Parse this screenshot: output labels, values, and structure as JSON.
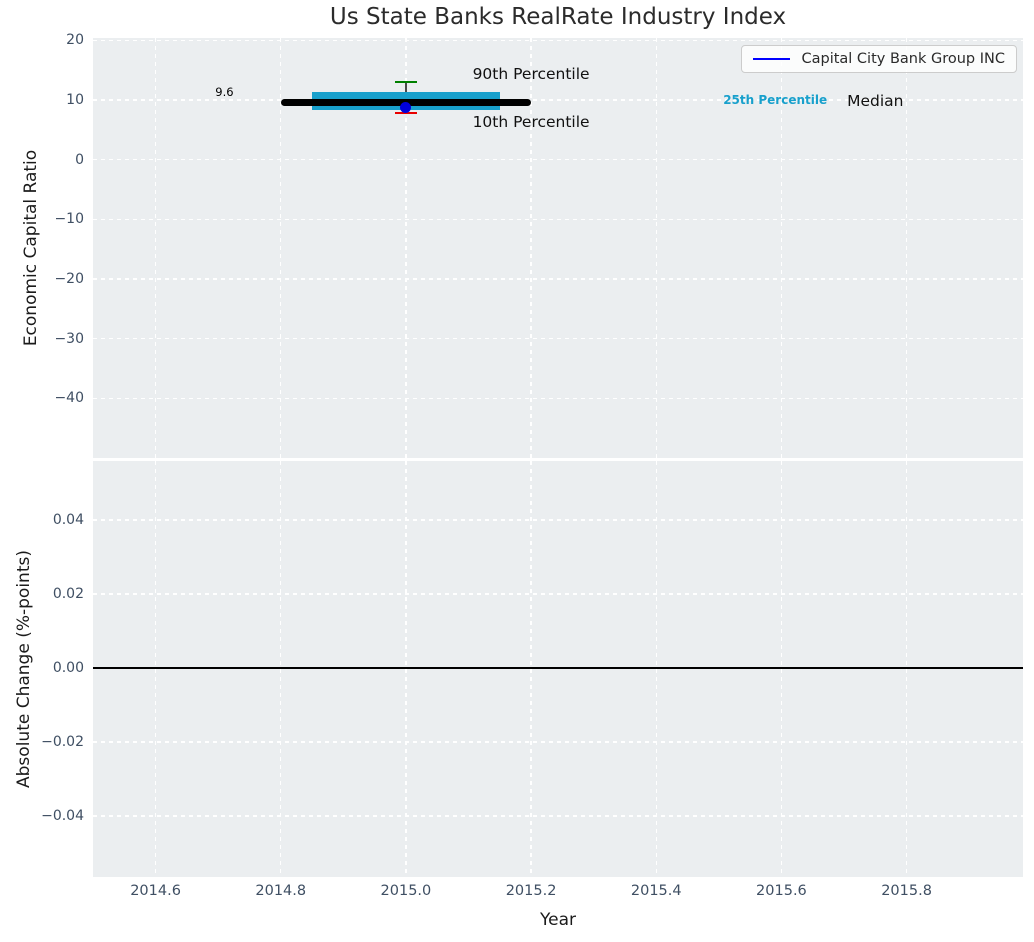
{
  "chart_data": {
    "type": "boxplot",
    "title": "Us State Banks RealRate Industry Index",
    "xlabel": "Year",
    "xlim": [
      2014.5,
      2015.986
    ],
    "xticks": [
      {
        "v": 2014.6,
        "label": "2014.6"
      },
      {
        "v": 2014.8,
        "label": "2014.8"
      },
      {
        "v": 2015.0,
        "label": "2015.0"
      },
      {
        "v": 2015.2,
        "label": "2015.2"
      },
      {
        "v": 2015.4,
        "label": "2015.4"
      },
      {
        "v": 2015.6,
        "label": "2015.6"
      },
      {
        "v": 2015.8,
        "label": "2015.8"
      }
    ],
    "legend": {
      "label": "Capital City Bank Group INC",
      "line_color": "#0000ff",
      "position": "top-right"
    },
    "grid": true,
    "top_panel": {
      "ylabel": "Economic Capital Ratio",
      "ylim": [
        -50,
        20.4
      ],
      "yticks": [
        {
          "v": 20,
          "label": "20"
        },
        {
          "v": 10,
          "label": "10"
        },
        {
          "v": 0,
          "label": "0"
        },
        {
          "v": -10,
          "label": "−10"
        },
        {
          "v": -20,
          "label": "−20"
        },
        {
          "v": -30,
          "label": "−30"
        },
        {
          "v": -40,
          "label": "−40"
        }
      ],
      "industry_box": {
        "year": 2015.0,
        "median": 9.6,
        "p25": 8.4,
        "p75": 11.4,
        "p10": 7.8,
        "p90": 13.0,
        "median_halfwidth_years": 0.2,
        "box_halfwidth_years": 0.15,
        "cap_halfwidth_years": 0.018,
        "colors": {
          "median": "#000000",
          "box": "#18a0cc",
          "p90_cap": "#008000",
          "p10_cap": "#e80000",
          "whisker": "#4a4a4a"
        }
      },
      "company_point": {
        "name": "Capital City Bank Group INC",
        "year": 2015.0,
        "value": 8.7,
        "color": "#0000dd"
      },
      "annotations": [
        {
          "text": "9.6",
          "x": 2014.71,
          "y": 11.35,
          "size": 11.5,
          "color": "#000000",
          "bold": false
        },
        {
          "text": "90th Percentile",
          "x": 2015.2,
          "y": 14.4,
          "size": 15.5,
          "color": "#111111",
          "bold": false
        },
        {
          "text": "10th Percentile",
          "x": 2015.2,
          "y": 6.3,
          "size": 15.5,
          "color": "#111111",
          "bold": false
        },
        {
          "text": "25th Percentile",
          "x": 2015.59,
          "y": 10.0,
          "size": 12,
          "color": "#18a0cc",
          "bold": true
        },
        {
          "text": "Median",
          "x": 2015.75,
          "y": 9.85,
          "size": 15.5,
          "color": "#111111",
          "bold": false
        }
      ]
    },
    "bottom_panel": {
      "ylabel": "Absolute Change (%-points)",
      "ylim": [
        -0.0565,
        0.056
      ],
      "yticks": [
        {
          "v": 0.04,
          "label": "0.04"
        },
        {
          "v": 0.02,
          "label": "0.02"
        },
        {
          "v": 0.0,
          "label": "0.00"
        },
        {
          "v": -0.02,
          "label": "−0.02"
        },
        {
          "v": -0.04,
          "label": "−0.04"
        }
      ],
      "zero_line": {
        "y": 0.0,
        "color": "#000000"
      }
    },
    "style": {
      "plot_bg": "#ebeef0",
      "grid_color": "#ffffff",
      "tick_color": "#3f4f63",
      "label_color": "#1b1b1b",
      "title_color": "#2b2b2b"
    }
  }
}
